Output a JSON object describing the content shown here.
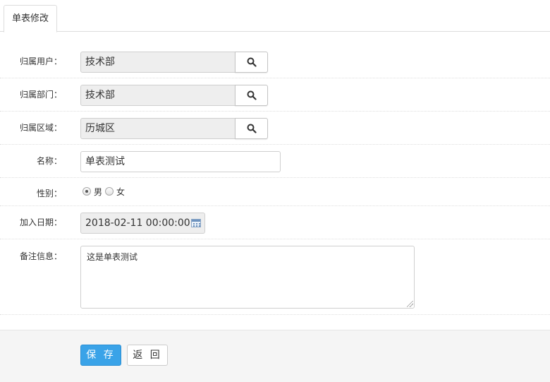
{
  "tabs": {
    "active_label": "单表修改"
  },
  "form": {
    "user": {
      "label": "归属用户：",
      "value": "技术部",
      "search_icon": "search-icon"
    },
    "office": {
      "label": "归属部门：",
      "value": "技术部",
      "search_icon": "search-icon"
    },
    "area": {
      "label": "归属区域：",
      "value": "历城区",
      "search_icon": "search-icon"
    },
    "name": {
      "label": "名称：",
      "value": "单表测试"
    },
    "sex": {
      "label": "性别：",
      "options": [
        "男",
        "女"
      ],
      "selected": "男"
    },
    "in_date": {
      "label": "加入日期：",
      "value": "2018-02-11 00:00:00",
      "icon": "calendar-icon"
    },
    "remarks": {
      "label": "备注信息：",
      "value": "这是单表测试"
    }
  },
  "actions": {
    "save_label": "保 存",
    "back_label": "返 回"
  },
  "colors": {
    "primary": "#3aa3e8",
    "readonly_bg": "#eeeeee",
    "footer_bg": "#f5f5f5"
  }
}
